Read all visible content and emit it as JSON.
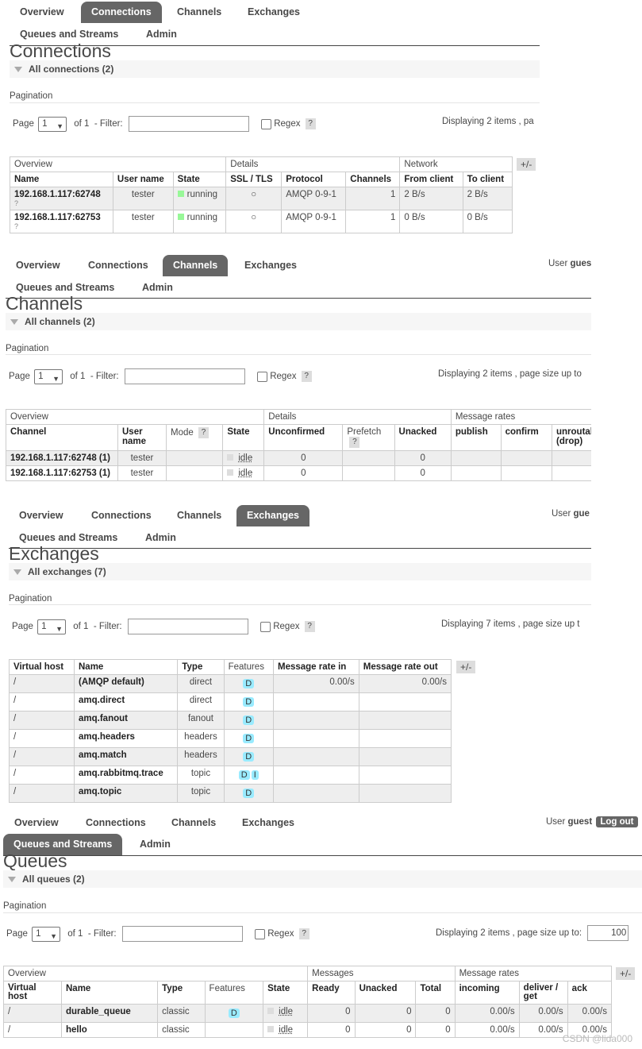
{
  "nav_tabs": [
    "Overview",
    "Connections",
    "Channels",
    "Exchanges",
    "Queues and Streams",
    "Admin"
  ],
  "user": {
    "label": "User",
    "name": "guest",
    "name_cut": "gues",
    "name_cut2": "gue",
    "logout": "Log out"
  },
  "common": {
    "pagination": "Pagination",
    "page_label": "Page",
    "page_value": "1",
    "of": "of 1",
    "filter": "- Filter:",
    "regex": "Regex",
    "help": "?",
    "plus_minus": "+/-"
  },
  "connections": {
    "title": "Connections",
    "section": "All connections (2)",
    "displaying": "Displaying 2 items , pa",
    "groups": [
      "Overview",
      "Details",
      "Network"
    ],
    "headers": [
      "Name",
      "User name",
      "State",
      "SSL / TLS",
      "Protocol",
      "Channels",
      "From client",
      "To client"
    ],
    "rows": [
      {
        "name": "192.168.1.117:62748",
        "q": "?",
        "user": "tester",
        "state": "running",
        "ssl": "○",
        "protocol": "AMQP 0-9-1",
        "channels": "1",
        "from": "2 B/s",
        "to": "2 B/s"
      },
      {
        "name": "192.168.1.117:62753",
        "q": "?",
        "user": "tester",
        "state": "running",
        "ssl": "○",
        "protocol": "AMQP 0-9-1",
        "channels": "1",
        "from": "0 B/s",
        "to": "0 B/s"
      }
    ]
  },
  "channels": {
    "title": "Channels",
    "section": "All channels (2)",
    "displaying": "Displaying 2 items , page size up to",
    "groups": [
      "Overview",
      "Details",
      "Message rates"
    ],
    "headers": [
      "Channel",
      "User name",
      "Mode",
      "State",
      "Unconfirmed",
      "Prefetch",
      "Unacked",
      "publish",
      "confirm",
      "unroutable (drop)"
    ],
    "rows": [
      {
        "channel": "192.168.1.117:62748 (1)",
        "user": "tester",
        "state": "idle",
        "unconfirmed": "0",
        "unacked": "0"
      },
      {
        "channel": "192.168.1.117:62753 (1)",
        "user": "tester",
        "state": "idle",
        "unconfirmed": "0",
        "unacked": "0"
      }
    ]
  },
  "exchanges": {
    "title": "Exchanges",
    "section": "All exchanges (7)",
    "displaying": "Displaying 7 items , page size up t",
    "headers": [
      "Virtual host",
      "Name",
      "Type",
      "Features",
      "Message rate in",
      "Message rate out"
    ],
    "rows": [
      {
        "vhost": "/",
        "name": "(AMQP default)",
        "type": "direct",
        "features": [
          "D"
        ],
        "rate_in": "0.00/s",
        "rate_out": "0.00/s"
      },
      {
        "vhost": "/",
        "name": "amq.direct",
        "type": "direct",
        "features": [
          "D"
        ],
        "rate_in": "",
        "rate_out": ""
      },
      {
        "vhost": "/",
        "name": "amq.fanout",
        "type": "fanout",
        "features": [
          "D"
        ],
        "rate_in": "",
        "rate_out": ""
      },
      {
        "vhost": "/",
        "name": "amq.headers",
        "type": "headers",
        "features": [
          "D"
        ],
        "rate_in": "",
        "rate_out": ""
      },
      {
        "vhost": "/",
        "name": "amq.match",
        "type": "headers",
        "features": [
          "D"
        ],
        "rate_in": "",
        "rate_out": ""
      },
      {
        "vhost": "/",
        "name": "amq.rabbitmq.trace",
        "type": "topic",
        "features": [
          "D",
          "I"
        ],
        "rate_in": "",
        "rate_out": ""
      },
      {
        "vhost": "/",
        "name": "amq.topic",
        "type": "topic",
        "features": [
          "D"
        ],
        "rate_in": "",
        "rate_out": ""
      }
    ]
  },
  "queues": {
    "title": "Queues",
    "section": "All queues (2)",
    "displaying": "Displaying 2 items , page size up to:",
    "page_size": "100",
    "groups": [
      "Overview",
      "Messages",
      "Message rates"
    ],
    "headers": [
      "Virtual host",
      "Name",
      "Type",
      "Features",
      "State",
      "Ready",
      "Unacked",
      "Total",
      "incoming",
      "deliver / get",
      "ack"
    ],
    "rows": [
      {
        "vhost": "/",
        "name": "durable_queue",
        "type": "classic",
        "features": [
          "D"
        ],
        "state": "idle",
        "ready": "0",
        "unacked": "0",
        "total": "0",
        "incoming": "0.00/s",
        "deliver": "0.00/s",
        "ack": "0.00/s"
      },
      {
        "vhost": "/",
        "name": "hello",
        "type": "classic",
        "features": [],
        "state": "idle",
        "ready": "0",
        "unacked": "0",
        "total": "0",
        "incoming": "0.00/s",
        "deliver": "0.00/s",
        "ack": "0.00/s"
      }
    ]
  },
  "watermark": "CSDN @lida000"
}
